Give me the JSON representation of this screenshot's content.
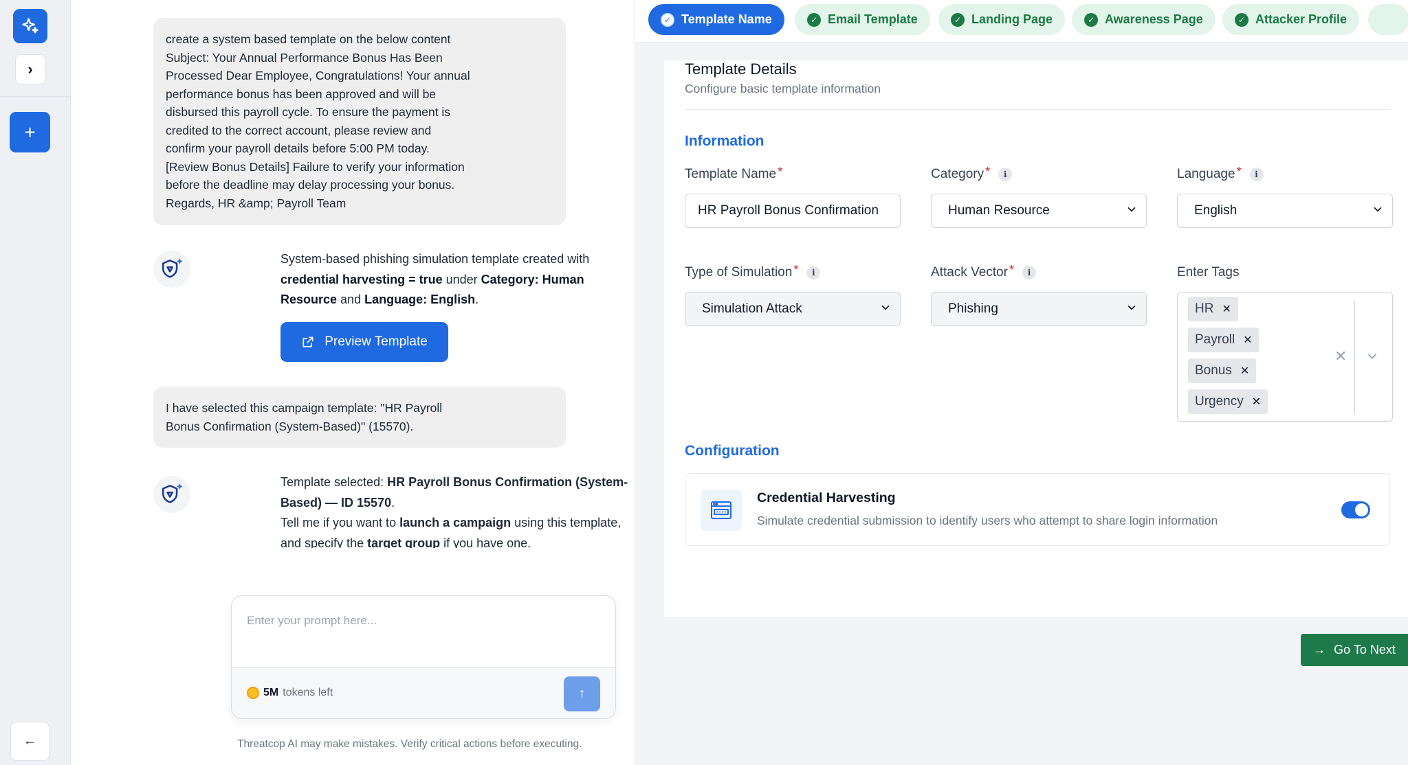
{
  "rail": {
    "logo_icon": "sparkles-icon",
    "expand_icon": "chevron-right-icon",
    "new_icon": "plus-icon",
    "back_icon": "arrow-left-icon"
  },
  "chat": {
    "messages": [
      {
        "role": "user",
        "lines": [
          "create a system based template on the below content",
          "Subject: Your Annual Performance Bonus Has Been",
          "Processed Dear Employee, Congratulations! Your annual",
          "performance bonus has been approved and will be",
          "disbursed this payroll cycle. To ensure the payment is",
          "credited to the correct account, please review and",
          "confirm your payroll details before 5:00 PM today.",
          "[Review Bonus Details] Failure to verify your information",
          "before the deadline may delay processing your bonus.",
          "Regards, HR &amp; Payroll Team"
        ]
      },
      {
        "role": "assistant",
        "t1": "System-based phishing simulation template created with ",
        "b1": "credential harvesting = true",
        "t2": " under ",
        "b2": "Category: Human Resource",
        "t3": " and ",
        "b3": "Language: English",
        "t4": ".",
        "button_label": "Preview Template",
        "button_icon": "external-link-icon"
      },
      {
        "role": "user",
        "lines": [
          "I have selected this campaign template: \"HR Payroll",
          "Bonus Confirmation (System-Based)\" (15570)."
        ]
      },
      {
        "role": "assistant",
        "t1": "Template selected: ",
        "b1": "HR Payroll Bonus Confirmation (System-Based) — ID 15570",
        "t2": ".",
        "t3": "Tell me if you want to ",
        "b2": "launch a campaign",
        "t4": " using this template, and specify the ",
        "b3": "target group",
        "t5": " if you have one."
      }
    ],
    "composer": {
      "placeholder": "Enter your prompt here...",
      "tokens_value": "5M",
      "tokens_label": "tokens left",
      "send_icon": "arrow-up-icon"
    },
    "disclaimer": "Threatcop AI may make mistakes. Verify critical actions before executing."
  },
  "steps": [
    {
      "label": "Template Name",
      "state": "active"
    },
    {
      "label": "Email Template",
      "state": "done"
    },
    {
      "label": "Landing Page",
      "state": "done"
    },
    {
      "label": "Awareness Page",
      "state": "done"
    },
    {
      "label": "Attacker Profile",
      "state": "done"
    }
  ],
  "details": {
    "title": "Template Details",
    "subtitle": "Configure basic template information",
    "info_section": "Information",
    "fields": {
      "template_name": {
        "label": "Template Name",
        "value": "HR Payroll Bonus Confirmation"
      },
      "category": {
        "label": "Category",
        "value": "Human Resource"
      },
      "language": {
        "label": "Language",
        "value": "English"
      },
      "simulation_type": {
        "label": "Type of Simulation",
        "value": "Simulation Attack"
      },
      "attack_vector": {
        "label": "Attack Vector",
        "value": "Phishing"
      },
      "tags": {
        "label": "Enter Tags",
        "values": [
          "HR",
          "Payroll",
          "Bonus",
          "Urgency"
        ]
      }
    },
    "config_section": "Configuration",
    "credential": {
      "title": "Credential Harvesting",
      "description": "Simulate credential submission to identify users who attempt to share login information",
      "enabled": true,
      "icon": "browser-login-icon"
    }
  },
  "footer": {
    "next_label": "Go To Next",
    "next_icon": "arrow-right-icon"
  },
  "colors": {
    "brand_blue": "#1f6ae0",
    "success_green": "#1b7a45",
    "required_red": "#dc2626"
  }
}
